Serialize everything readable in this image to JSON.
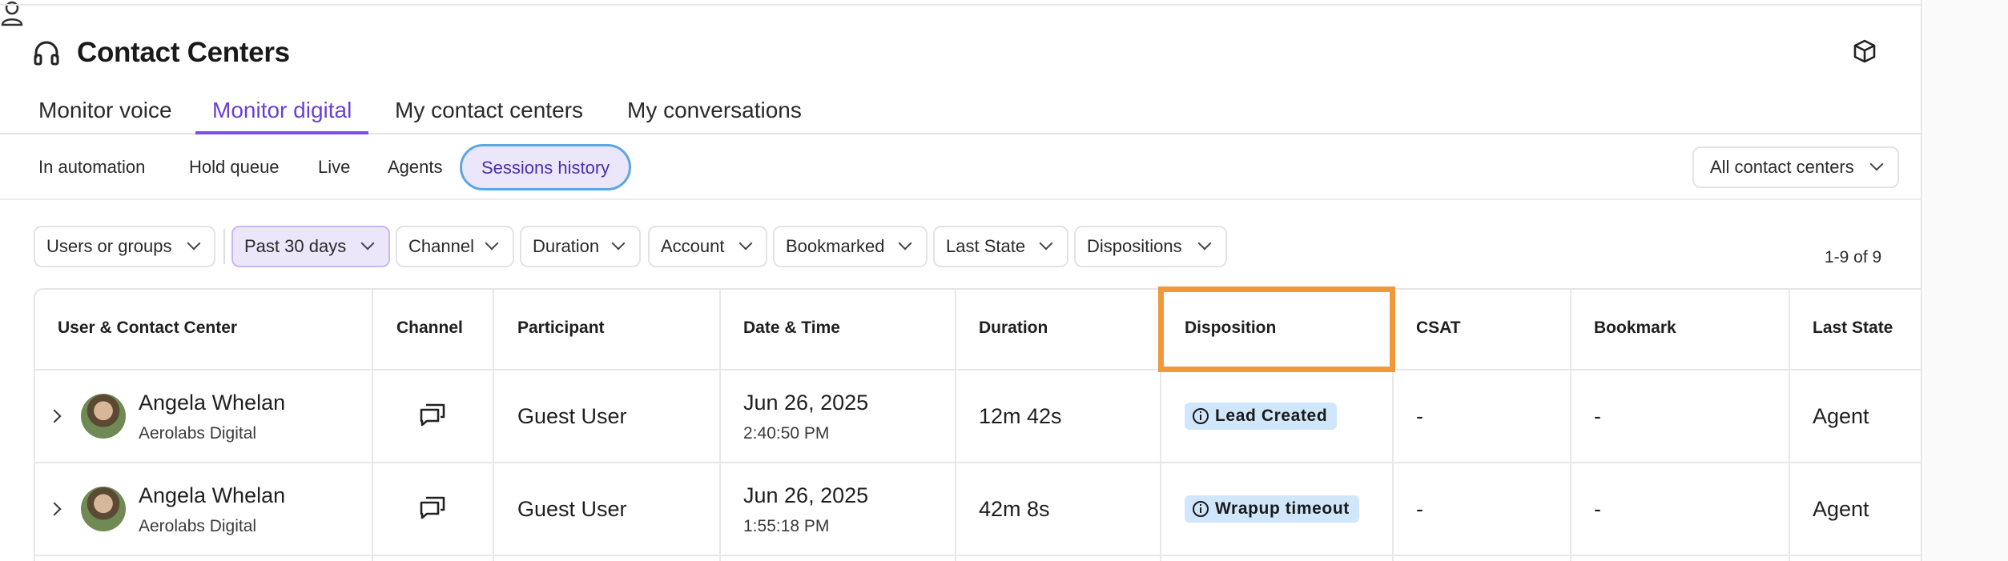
{
  "app": {
    "title": "Contact Centers"
  },
  "tabs": [
    {
      "label": "Monitor voice"
    },
    {
      "label": "Monitor digital"
    },
    {
      "label": "My contact centers"
    },
    {
      "label": "My conversations"
    }
  ],
  "subtabs": [
    {
      "label": "In automation"
    },
    {
      "label": "Hold queue"
    },
    {
      "label": "Live"
    },
    {
      "label": "Agents"
    },
    {
      "label": "Sessions history"
    }
  ],
  "contact_center_select": {
    "value": "All contact centers"
  },
  "filters": [
    {
      "label": "Users or groups"
    },
    {
      "label": "Past 30 days"
    },
    {
      "label": "Channel"
    },
    {
      "label": "Duration"
    },
    {
      "label": "Account"
    },
    {
      "label": "Bookmarked"
    },
    {
      "label": "Last State"
    },
    {
      "label": "Dispositions"
    }
  ],
  "pagination": {
    "count": "1-9 of 9"
  },
  "table": {
    "columns": [
      "User & Contact Center",
      "Channel",
      "Participant",
      "Date & Time",
      "Duration",
      "Disposition",
      "CSAT",
      "Bookmark",
      "Last State"
    ],
    "rows": [
      {
        "user": "Angela Whelan",
        "center": "Aerolabs Digital",
        "channel_icon": "chat-icon",
        "participant": "Guest User",
        "date": "Jun 26, 2025",
        "time": "2:40:50 PM",
        "duration": "12m 42s",
        "disposition": "Lead Created",
        "csat": "-",
        "bookmark": "-",
        "last_state": "Agent"
      },
      {
        "user": "Angela Whelan",
        "center": "Aerolabs Digital",
        "channel_icon": "chat-icon",
        "participant": "Guest User",
        "date": "Jun 26, 2025",
        "time": "1:55:18 PM",
        "duration": "42m 8s",
        "disposition": "Wrapup timeout",
        "csat": "-",
        "bookmark": "-",
        "last_state": "Agent"
      }
    ]
  },
  "colors": {
    "accent": "#7c4ee4",
    "badge": "#cfe6fb",
    "highlight": "#f0983a"
  }
}
